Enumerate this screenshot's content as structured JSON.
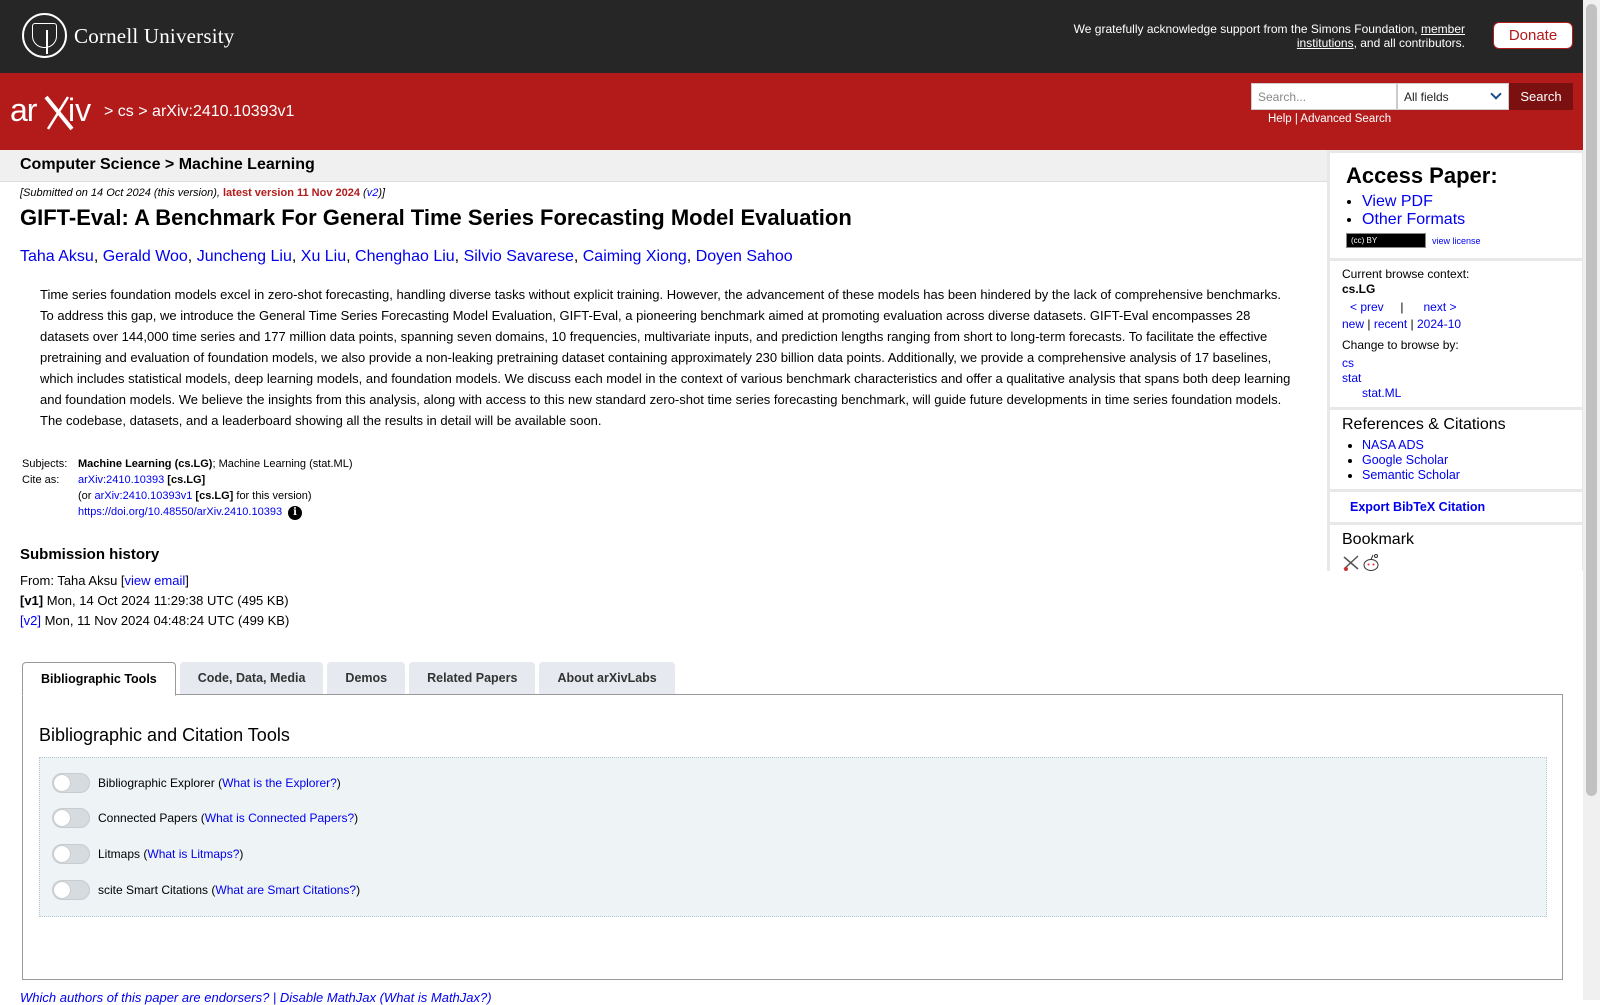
{
  "cornell": {
    "name": "Cornell University",
    "ack_prefix": "We gratefully acknowledge support from the Simons Foundation,",
    "ack_link": "member institutions",
    "ack_suffix": ", and all contributors.",
    "donate_label": "Donate"
  },
  "header": {
    "logo_text": "arXiv",
    "crumb_cs": "cs",
    "crumb_sep": ">",
    "crumb_id": "arXiv:2410.10393v1",
    "search_placeholder": "Search...",
    "search_field": "All fields",
    "search_button": "Search",
    "help_label": "Help",
    "help_sep": "|",
    "advanced_label": "Advanced Search"
  },
  "subject_heading": "Computer Science > Machine Learning",
  "paper": {
    "submitted_prefix": "[Submitted on 14 Oct 2024 (this version), ",
    "latest_version": "latest version 11 Nov 2024",
    "version_link": "v2",
    "title": "GIFT-Eval: A Benchmark For General Time Series Forecasting Model Evaluation",
    "authors": [
      "Taha Aksu",
      "Gerald Woo",
      "Juncheng Liu",
      "Xu Liu",
      "Chenghao Liu",
      "Silvio Savarese",
      "Caiming Xiong",
      "Doyen Sahoo"
    ],
    "abstract": "Time series foundation models excel in zero-shot forecasting, handling diverse tasks without explicit training. However, the advancement of these models has been hindered by the lack of comprehensive benchmarks. To address this gap, we introduce the General Time Series Forecasting Model Evaluation, GIFT-Eval, a pioneering benchmark aimed at promoting evaluation across diverse datasets. GIFT-Eval encompasses 28 datasets over 144,000 time series and 177 million data points, spanning seven domains, 10 frequencies, multivariate inputs, and prediction lengths ranging from short to long-term forecasts. To facilitate the effective pretraining and evaluation of foundation models, we also provide a non-leaking pretraining dataset containing approximately 230 billion data points. Additionally, we provide a comprehensive analysis of 17 baselines, which includes statistical models, deep learning models, and foundation models. We discuss each model in the context of various benchmark characteristics and offer a qualitative analysis that spans both deep learning and foundation models. We believe the insights from this analysis, along with access to this new standard zero-shot time series forecasting benchmark, will guide future developments in time series foundation models. The codebase, datasets, and a leaderboard showing all the results in detail will be available soon."
  },
  "meta": {
    "subjects_label": "Subjects:",
    "subjects_primary": "Machine Learning (cs.LG)",
    "subjects_rest": "; Machine Learning (stat.ML)",
    "cite_label": "Cite as:",
    "cite_id": "arXiv:2410.10393",
    "cite_tag": "[cs.LG]",
    "cite_v_prefix": "(or ",
    "cite_v_id": "arXiv:2410.10393v1",
    "cite_v_tag": "[cs.LG]",
    "cite_v_suffix": " for this version)",
    "doi": "https://doi.org/10.48550/arXiv.2410.10393",
    "info_icon": "i"
  },
  "history": {
    "title": "Submission history",
    "from_prefix": "From: Taha Aksu [",
    "view_email": "view email",
    "from_suffix": "]",
    "v1_label": "[v1]",
    "v1_text": " Mon, 14 Oct 2024 11:29:38 UTC (495 KB)",
    "v2_label": "[v2]",
    "v2_text": " Mon, 11 Nov 2024 04:48:24 UTC (499 KB)"
  },
  "sidebar": {
    "access_title": "Access Paper:",
    "view_pdf": "View PDF",
    "other_formats": "Other Formats",
    "cc_badge": "(cc) BY",
    "view_license": "view license",
    "context_label": "Current browse context:",
    "context_value": "cs.LG",
    "prev": "< prev",
    "pipe": "|",
    "next": "next >",
    "new": "new",
    "recent": "recent",
    "month": "2024-10",
    "change_label": "Change to browse by:",
    "browse_cs": "cs",
    "browse_stat": "stat",
    "browse_statml": "stat.ML",
    "refs_title": "References & Citations",
    "refs": [
      "NASA ADS",
      "Google Scholar",
      "Semantic Scholar"
    ],
    "bibtex": "Export BibTeX Citation",
    "bookmark_title": "Bookmark"
  },
  "tabs": [
    "Bibliographic Tools",
    "Code, Data, Media",
    "Demos",
    "Related Papers",
    "About arXivLabs"
  ],
  "panel": {
    "title": "Bibliographic and Citation Tools",
    "tools": [
      {
        "label": "Bibliographic Explorer",
        "help": "What is the Explorer?"
      },
      {
        "label": "Connected Papers",
        "help": "What is Connected Papers?"
      },
      {
        "label": "Litmaps",
        "help": "What is Litmaps?"
      },
      {
        "label": "scite Smart Citations",
        "help": "What are Smart Citations?"
      }
    ]
  },
  "footer": {
    "text": "Which authors of this paper are endorsers? | Disable MathJax (What is MathJax?)"
  },
  "colors": {
    "arxiv_red": "#b31b1b",
    "cornell_dark": "#262626",
    "link_blue": "#0000ee"
  }
}
